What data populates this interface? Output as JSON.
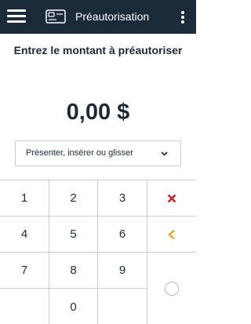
{
  "header": {
    "title": "Préautorisation",
    "menu_icon": "hamburger-menu-icon",
    "card_icon": "card-reader-icon",
    "more_icon": "more-vertical-icon"
  },
  "prompt": "Entrez le montant à préautoriser",
  "amount": "0,00 $",
  "entry_method": {
    "selected": "Présenter, insérer ou glisser",
    "icon": "chevron-down-icon"
  },
  "keypad": {
    "keys": [
      "1",
      "2",
      "3",
      "4",
      "5",
      "6",
      "7",
      "8",
      "9",
      "0"
    ],
    "clear_icon": "close-icon",
    "backspace_icon": "chevron-left-icon",
    "confirm_icon": "radio-circle-icon"
  },
  "colors": {
    "header_bg": "#1a2a38",
    "text": "#1c2a37",
    "clear": "#c8282d",
    "backspace": "#f39c12"
  }
}
